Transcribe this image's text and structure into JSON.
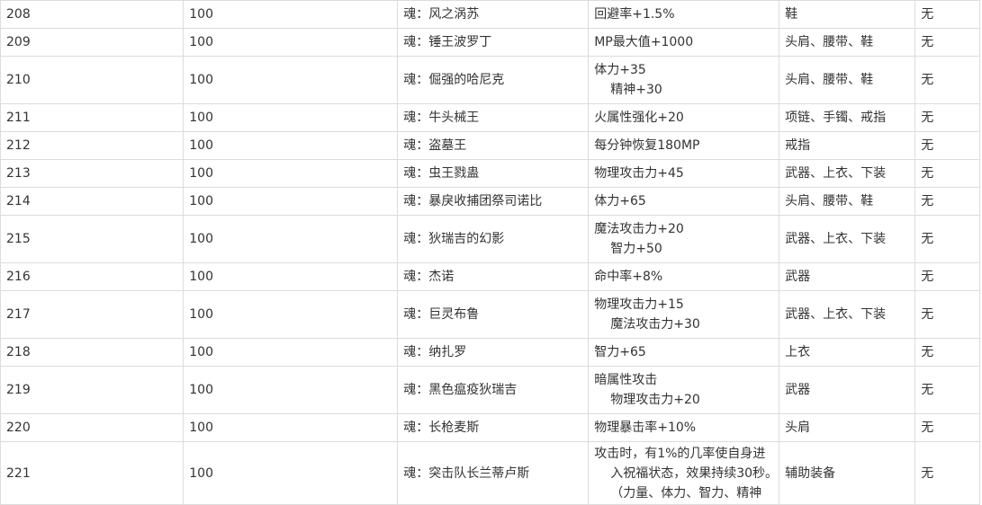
{
  "rows": [
    {
      "id": "208",
      "level": "100",
      "name": "魂：风之涡苏",
      "effect": [
        "回避率+1.5%"
      ],
      "slots": "鞋",
      "note": "无",
      "height": 1
    },
    {
      "id": "209",
      "level": "100",
      "name": "魂：锤王波罗丁",
      "effect": [
        "MP最大值+1000"
      ],
      "slots": "头肩、腰带、鞋",
      "note": "无",
      "height": 1
    },
    {
      "id": "210",
      "level": "100",
      "name": "魂：倔强的哈尼克",
      "effect": [
        "体力+35",
        "精神+30"
      ],
      "slots": "头肩、腰带、鞋",
      "note": "无",
      "height": 2
    },
    {
      "id": "211",
      "level": "100",
      "name": "魂：牛头械王",
      "effect": [
        "火属性强化+20"
      ],
      "slots": "项链、手镯、戒指",
      "note": "无",
      "height": 1
    },
    {
      "id": "212",
      "level": "100",
      "name": "魂：盗墓王",
      "effect": [
        "每分钟恢复180MP"
      ],
      "slots": "戒指",
      "note": "无",
      "height": 1
    },
    {
      "id": "213",
      "level": "100",
      "name": "魂：虫王戮蛊",
      "effect": [
        "物理攻击力+45"
      ],
      "slots": "武器、上衣、下装",
      "note": "无",
      "height": 1
    },
    {
      "id": "214",
      "level": "100",
      "name": "魂：暴戾收捕团祭司诺比",
      "effect": [
        "体力+65"
      ],
      "slots": "头肩、腰带、鞋",
      "note": "无",
      "height": 1
    },
    {
      "id": "215",
      "level": "100",
      "name": "魂：狄瑞吉的幻影",
      "effect": [
        "魔法攻击力+20",
        "智力+50"
      ],
      "slots": "武器、上衣、下装",
      "note": "无",
      "height": 2
    },
    {
      "id": "216",
      "level": "100",
      "name": "魂：杰诺",
      "effect": [
        "命中率+8%"
      ],
      "slots": "武器",
      "note": "无",
      "height": 1
    },
    {
      "id": "217",
      "level": "100",
      "name": "魂：巨灵布鲁",
      "effect": [
        "物理攻击力+15",
        "魔法攻击力+30"
      ],
      "slots": "武器、上衣、下装",
      "note": "无",
      "height": 2
    },
    {
      "id": "218",
      "level": "100",
      "name": "魂：纳扎罗",
      "effect": [
        "智力+65"
      ],
      "slots": "上衣",
      "note": "无",
      "height": 1
    },
    {
      "id": "219",
      "level": "100",
      "name": "魂：黑色瘟疫狄瑞吉",
      "effect": [
        "暗属性攻击",
        "物理攻击力+20"
      ],
      "slots": "武器",
      "note": "无",
      "height": 2
    },
    {
      "id": "220",
      "level": "100",
      "name": "魂：长枪麦斯",
      "effect": [
        "物理暴击率+10%"
      ],
      "slots": "头肩",
      "note": "无",
      "height": 1
    },
    {
      "id": "221",
      "level": "100",
      "name": "魂：突击队长兰蒂卢斯",
      "effect": [
        "攻击时，有1%的几率使自身进",
        "入祝福状态，效果持续30秒。",
        "（力量、体力、智力、精神"
      ],
      "slots": "辅助装备",
      "note": "无",
      "height": 3
    }
  ]
}
